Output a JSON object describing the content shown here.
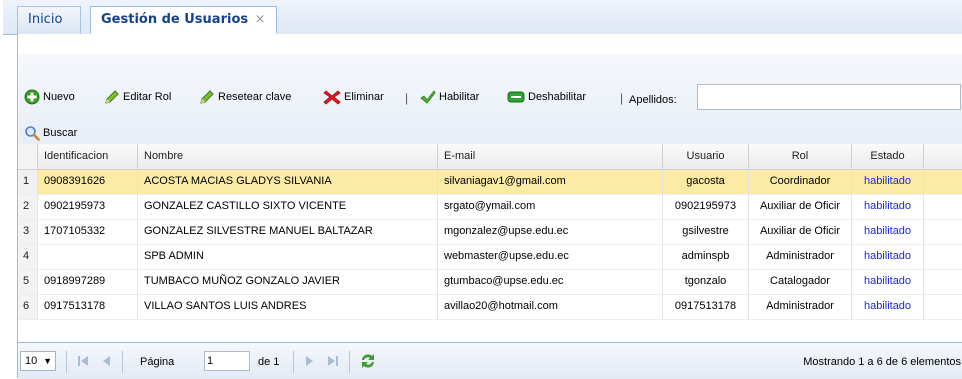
{
  "tabs": [
    {
      "label": "Inicio"
    },
    {
      "label": "Gestión de Usuarios",
      "close": "×"
    }
  ],
  "toolbar": {
    "nuevo": "Nuevo",
    "editar_rol": "Editar Rol",
    "resetear_clave": "Resetear clave",
    "eliminar": "Eliminar",
    "habilitar": "Habilitar",
    "deshabilitar": "Deshabilitar",
    "separator": "|",
    "apellidos_label": "Apellidos:",
    "apellidos_value": "",
    "buscar": "Buscar"
  },
  "grid": {
    "headers": {
      "num": "",
      "identificacion": "Identificacion",
      "nombre": "Nombre",
      "email": "E-mail",
      "usuario": "Usuario",
      "rol": "Rol",
      "estado": "Estado"
    },
    "rows": [
      {
        "num": "1",
        "identificacion": "0908391626",
        "nombre": "ACOSTA MACIAS GLADYS SILVANIA",
        "email": "silvaniagav1@gmail.com",
        "usuario": "gacosta",
        "rol": "Coordinador",
        "estado": "habilitado",
        "selected": true
      },
      {
        "num": "2",
        "identificacion": "0902195973",
        "nombre": "GONZALEZ CASTILLO SIXTO VICENTE",
        "email": "srgato@ymail.com",
        "usuario": "0902195973",
        "rol": "Auxiliar de Oficir",
        "estado": "habilitado",
        "selected": false
      },
      {
        "num": "3",
        "identificacion": "1707105332",
        "nombre": "GONZALEZ SILVESTRE MANUEL BALTAZAR",
        "email": "mgonzalez@upse.edu.ec",
        "usuario": "gsilvestre",
        "rol": "Auxiliar de Oficir",
        "estado": "habilitado",
        "selected": false
      },
      {
        "num": "4",
        "identificacion": "",
        "nombre": "SPB ADMIN",
        "email": "webmaster@upse.edu.ec",
        "usuario": "adminspb",
        "rol": "Administrador",
        "estado": "habilitado",
        "selected": false
      },
      {
        "num": "5",
        "identificacion": "0918997289",
        "nombre": "TUMBACO MUÑOZ GONZALO JAVIER",
        "email": "gtumbaco@upse.edu.ec",
        "usuario": "tgonzalo",
        "rol": "Catalogador",
        "estado": "habilitado",
        "selected": false
      },
      {
        "num": "6",
        "identificacion": "0917513178",
        "nombre": "VILLAO SANTOS LUIS ANDRES",
        "email": "avillao20@hotmail.com",
        "usuario": "0917513178",
        "rol": "Administrador",
        "estado": "habilitado",
        "selected": false
      }
    ]
  },
  "pager": {
    "page_size": "10",
    "pagina_label": "Página",
    "page_value": "1",
    "de_label": "de 1",
    "status": "Mostrando 1 a 6 de 6 elementos"
  },
  "colors": {
    "accent": "#99bbe8",
    "tab_text": "#15428b",
    "selected_row": "#fbeba5",
    "link": "#1a29d8"
  },
  "icons": {
    "nuevo": "add-icon",
    "editar_rol": "pencil-icon",
    "resetear_clave": "pencil-icon",
    "eliminar": "delete-x-icon",
    "habilitar": "checkmark-icon",
    "deshabilitar": "minus-toggle-icon",
    "buscar": "search-icon",
    "pager": [
      "first-page-icon",
      "prev-page-icon",
      "next-page-icon",
      "last-page-icon",
      "refresh-icon"
    ]
  }
}
